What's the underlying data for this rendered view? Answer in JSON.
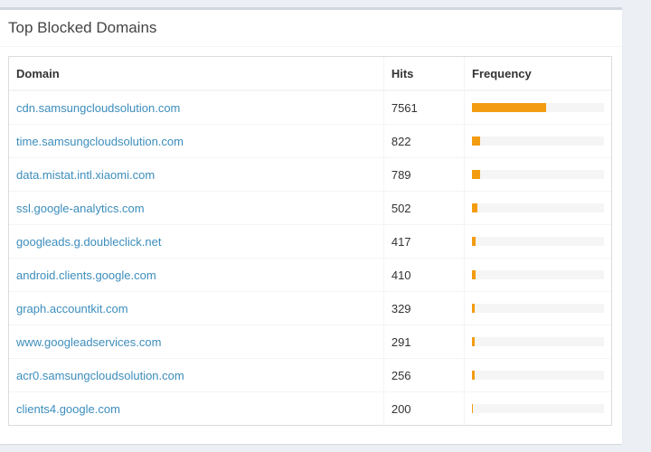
{
  "panel": {
    "title": "Top Blocked Domains"
  },
  "table": {
    "headers": {
      "domain": "Domain",
      "hits": "Hits",
      "frequency": "Frequency"
    },
    "rows": [
      {
        "domain": "cdn.samsungcloudsolution.com",
        "hits": "7561",
        "frequency_pct": 56
      },
      {
        "domain": "time.samsungcloudsolution.com",
        "hits": "822",
        "frequency_pct": 6
      },
      {
        "domain": "data.mistat.intl.xiaomi.com",
        "hits": "789",
        "frequency_pct": 6
      },
      {
        "domain": "ssl.google-analytics.com",
        "hits": "502",
        "frequency_pct": 4
      },
      {
        "domain": "googleads.g.doubleclick.net",
        "hits": "417",
        "frequency_pct": 3
      },
      {
        "domain": "android.clients.google.com",
        "hits": "410",
        "frequency_pct": 3
      },
      {
        "domain": "graph.accountkit.com",
        "hits": "329",
        "frequency_pct": 2
      },
      {
        "domain": "www.googleadservices.com",
        "hits": "291",
        "frequency_pct": 2
      },
      {
        "domain": "acr0.samsungcloudsolution.com",
        "hits": "256",
        "frequency_pct": 2
      },
      {
        "domain": "clients4.google.com",
        "hits": "200",
        "frequency_pct": 1
      }
    ]
  },
  "colors": {
    "link": "#3c8dbc",
    "bar": "#f39c12",
    "track": "#f5f5f5"
  }
}
